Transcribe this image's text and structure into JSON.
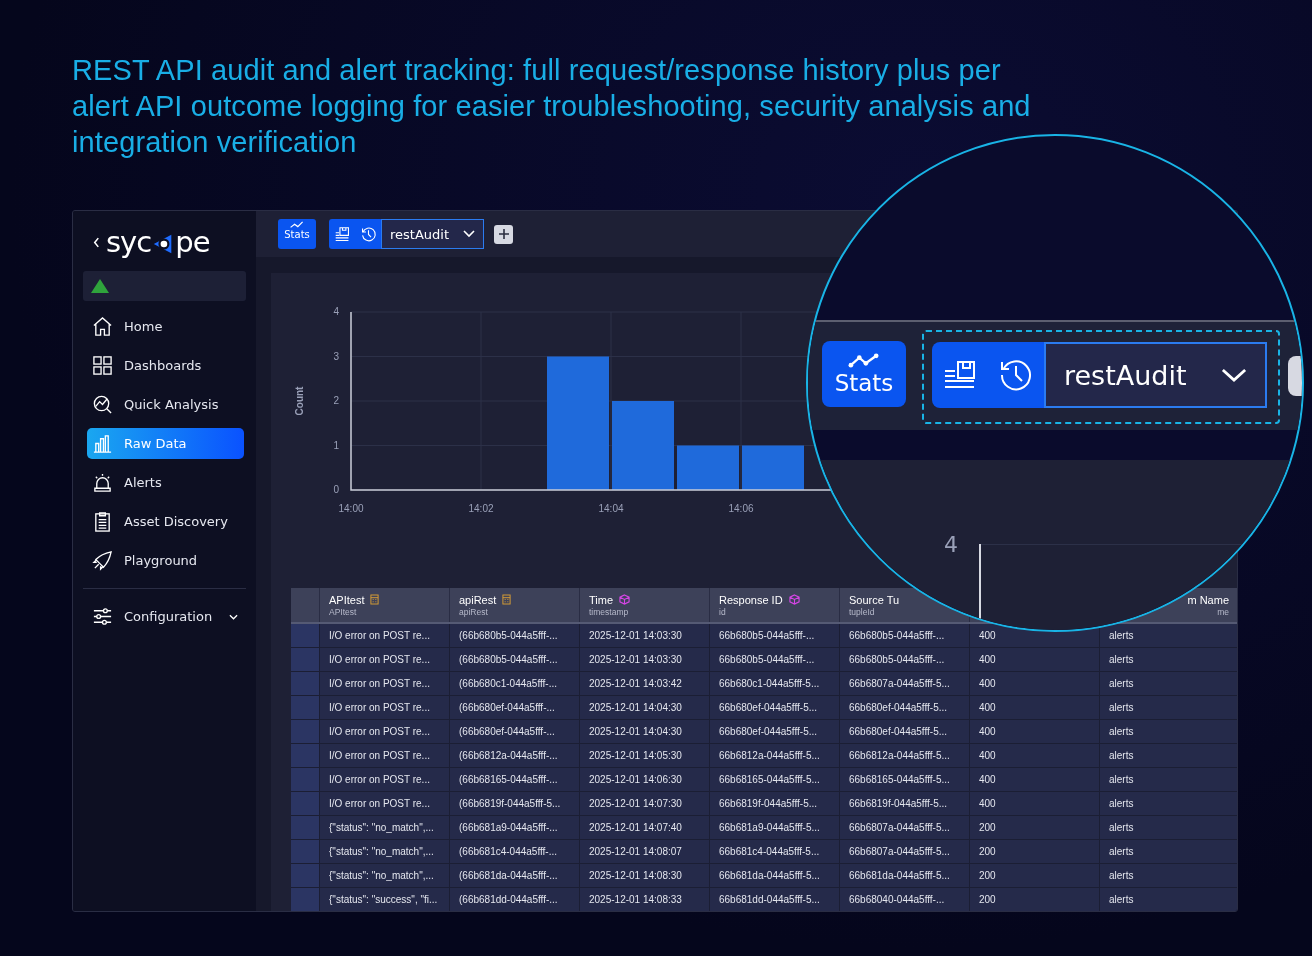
{
  "headline": "REST API audit and alert tracking: full request/response history plus per alert API outcome logging for easier troubleshooting, security analysis and integration verification",
  "logo": {
    "text_before": "syc",
    "text_after": "pe"
  },
  "sidebar": {
    "items": [
      {
        "label": "Home",
        "selected": false
      },
      {
        "label": "Dashboards",
        "selected": false
      },
      {
        "label": "Quick Analysis",
        "selected": false
      },
      {
        "label": "Raw Data",
        "selected": true
      },
      {
        "label": "Alerts",
        "selected": false
      },
      {
        "label": "Asset Discovery",
        "selected": false
      },
      {
        "label": "Playground",
        "selected": false
      }
    ],
    "footer_item": {
      "label": "Configuration",
      "expanded": false
    }
  },
  "toolbar": {
    "stats_label": "Stats",
    "query_name": "restAudit"
  },
  "chart": {
    "chart_data": {
      "type": "bar",
      "ylabel": "Count",
      "categories": [
        "14:00",
        null,
        "14:02",
        null,
        "14:04",
        null,
        "14:06"
      ],
      "values": [
        null,
        null,
        null,
        3,
        2,
        1,
        1
      ],
      "yticks": [
        0,
        1,
        2,
        3,
        4
      ],
      "ylim": [
        0,
        4
      ],
      "grid": true
    }
  },
  "table": {
    "columns": [
      {
        "title": "APItest",
        "subtitle": "APItest"
      },
      {
        "title": "apiRest",
        "subtitle": "apiRest"
      },
      {
        "title": "Time",
        "subtitle": "timestamp"
      },
      {
        "title": "Response ID",
        "subtitle": "id"
      },
      {
        "title": "Source Tu",
        "subtitle": "tupleId"
      },
      {},
      {
        "title": "m Name",
        "subtitle": "me"
      }
    ],
    "rows": [
      [
        "I/O error on POST re...",
        "(66b680b5-044a5fff-...",
        "2025-12-01 14:03:30",
        "66b680b5-044a5fff-...",
        "66b680b5-044a5fff-...",
        "400",
        "alerts"
      ],
      [
        "I/O error on POST re...",
        "(66b680b5-044a5fff-...",
        "2025-12-01 14:03:30",
        "66b680b5-044a5fff-...",
        "66b680b5-044a5fff-...",
        "400",
        "alerts"
      ],
      [
        "I/O error on POST re...",
        "(66b680c1-044a5fff-...",
        "2025-12-01 14:03:42",
        "66b680c1-044a5fff-5...",
        "66b6807a-044a5fff-5...",
        "400",
        "alerts"
      ],
      [
        "I/O error on POST re...",
        "(66b680ef-044a5fff-...",
        "2025-12-01 14:04:30",
        "66b680ef-044a5fff-5...",
        "66b680ef-044a5fff-5...",
        "400",
        "alerts"
      ],
      [
        "I/O error on POST re...",
        "(66b680ef-044a5fff-...",
        "2025-12-01 14:04:30",
        "66b680ef-044a5fff-5...",
        "66b680ef-044a5fff-5...",
        "400",
        "alerts"
      ],
      [
        "I/O error on POST re...",
        "(66b6812a-044a5fff-...",
        "2025-12-01 14:05:30",
        "66b6812a-044a5fff-5...",
        "66b6812a-044a5fff-5...",
        "400",
        "alerts"
      ],
      [
        "I/O error on POST re...",
        "(66b68165-044a5fff-...",
        "2025-12-01 14:06:30",
        "66b68165-044a5fff-5...",
        "66b68165-044a5fff-5...",
        "400",
        "alerts"
      ],
      [
        "I/O error on POST re...",
        "(66b6819f-044a5fff-5...",
        "2025-12-01 14:07:30",
        "66b6819f-044a5fff-5...",
        "66b6819f-044a5fff-5...",
        "400",
        "alerts"
      ],
      [
        "{\"status\": \"no_match\",...",
        "(66b681a9-044a5fff-...",
        "2025-12-01 14:07:40",
        "66b681a9-044a5fff-5...",
        "66b6807a-044a5fff-5...",
        "200",
        "alerts"
      ],
      [
        "{\"status\": \"no_match\",...",
        "(66b681c4-044a5fff-...",
        "2025-12-01 14:08:07",
        "66b681c4-044a5fff-5...",
        "66b6807a-044a5fff-5...",
        "200",
        "alerts"
      ],
      [
        "{\"status\": \"no_match\",...",
        "(66b681da-044a5fff-...",
        "2025-12-01 14:08:30",
        "66b681da-044a5fff-5...",
        "66b681da-044a5fff-5...",
        "200",
        "alerts"
      ],
      [
        "{\"status\": \"success\", \"fi...",
        "(66b681dd-044a5fff-...",
        "2025-12-01 14:08:33",
        "66b681dd-044a5fff-5...",
        "66b68040-044a5fff-...",
        "200",
        "alerts"
      ]
    ]
  },
  "magnifier": {
    "stats_label": "Stats",
    "query_name": "restAudit",
    "axis_tick": "4"
  }
}
